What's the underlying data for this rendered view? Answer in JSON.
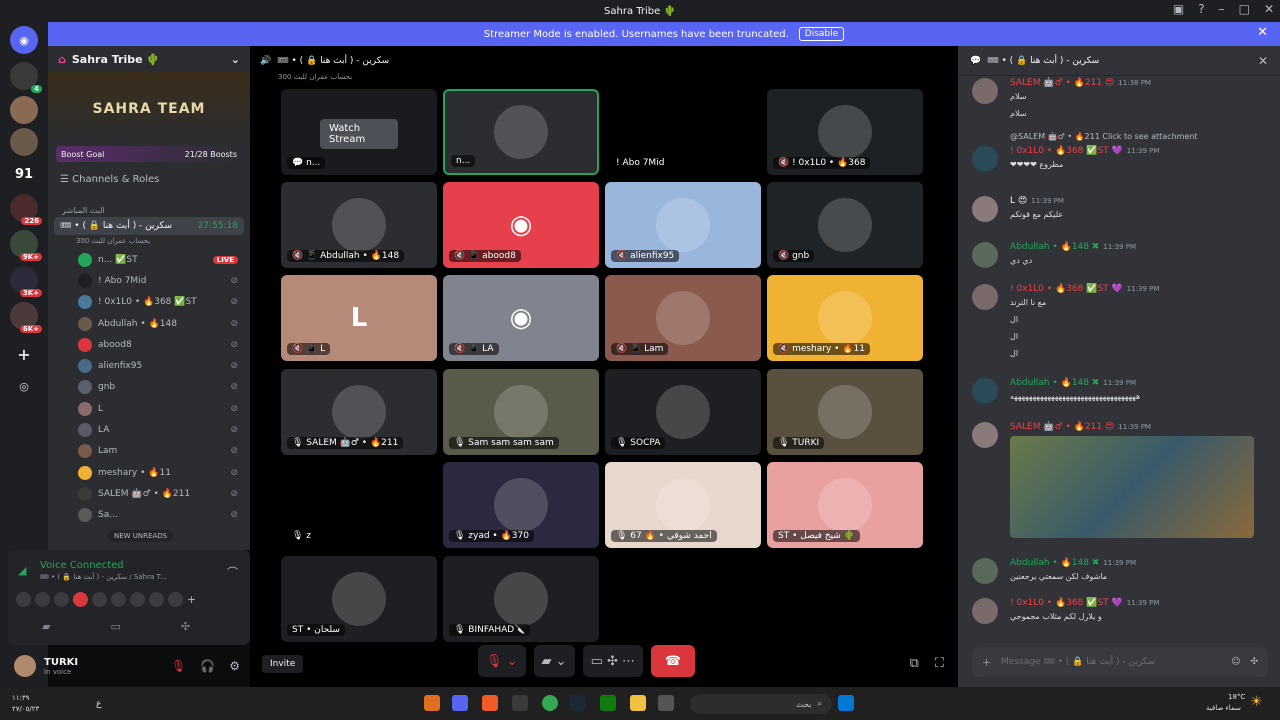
{
  "window": {
    "title": "Sahra Tribe 🌵"
  },
  "banner": {
    "text": "Streamer Mode is enabled. Usernames have been truncated.",
    "button": "Disable"
  },
  "rail": {
    "count_label": "91",
    "badges": [
      "226",
      "9K+",
      "3K+",
      "6K+"
    ]
  },
  "sidebar": {
    "guild_name": "Sahra Tribe 🌵",
    "banner_text": "SAHRA TEAM",
    "boost_goal": "Boost Goal",
    "boost_count": "21/28 Boosts",
    "channels_roles": "Channels & Roles",
    "category": "البث المباشر",
    "voice_channel": "🎟 • ( 🔒 أبث هنا ) - سكرين",
    "voice_timer": "27:55:18",
    "voice_sub": "300 بحساب عمران للبث",
    "live_badge": "LIVE",
    "users": [
      "n... ✅ST",
      "! Abo 7Mid",
      "! 0x1L0 • 🔥368 ✅ST",
      "Abdullah • 🔥148",
      "abood8",
      "alienfix95",
      "gnb",
      "L",
      "LA",
      "Lam",
      "meshary • 🔥11",
      "SALEM 🤖♂ • 🔥211",
      "Sa..."
    ],
    "new_unreads": "NEW UNREADS"
  },
  "voice_panel": {
    "status": "Voice Connected",
    "channel": "🎟 • ( 🔒 أبث هنا ) - سكرين / Sahra T..."
  },
  "user": {
    "name": "TURKI",
    "status": "In voice"
  },
  "stage": {
    "header": "🎟 • ( 🔒 أبث هنا ) - سكرين",
    "sub": "300 بحساب عمران للبث",
    "watch_label": "Watch Stream",
    "tiles": [
      {
        "label": "💬 n...",
        "bg": "#1a1b1e"
      },
      {
        "label": "n...",
        "bg": "#2b2d31"
      },
      {
        "label": "! Abo 7Mid",
        "bg": "#000000"
      },
      {
        "label": "🔇 ! 0x1L0 • 🔥368",
        "bg": "#1e2124"
      },
      {
        "label": "🔇 📱 Abdullah • 🔥148",
        "bg": "#2b2d31"
      },
      {
        "label": "🔇 📱 abood8",
        "bg": "#e5404b"
      },
      {
        "label": "🔇 alienfix95",
        "bg": "#9bb6dd"
      },
      {
        "label": "🔇 gnb",
        "bg": "#1f2428"
      },
      {
        "label": "🔇 📱 L",
        "bg": "#b58a79"
      },
      {
        "label": "🔇 📱 LA",
        "bg": "#80848e"
      },
      {
        "label": "🔇 📱 Lam",
        "bg": "#8a5a4e"
      },
      {
        "label": "🔇 meshary • 🔥11",
        "bg": "#f0b232"
      },
      {
        "label": "🎙 SALEM 🤖♂ • 🔥211",
        "bg": "#2b2d31"
      },
      {
        "label": "🎙 Sam sam sam sam",
        "bg": "#5a5a4a"
      },
      {
        "label": "🎙 SOCPA",
        "bg": "#1e1f22"
      },
      {
        "label": "🎙 TURKI",
        "bg": "#5a5040"
      },
      {
        "label": "🎙 z",
        "bg": "#000000"
      },
      {
        "label": "🎙 zyad • 🔥370",
        "bg": "#2b2840"
      },
      {
        "label": "🎙 67 🔥 • احمد شوقي",
        "bg": "#e8d7cc"
      },
      {
        "label": "ST • شيخ فيصل 🌵",
        "bg": "#e8a0a0"
      },
      {
        "label": "ST • سلحان",
        "bg": "#1e1f22"
      },
      {
        "label": "🎙 BINFAHAD🔪",
        "bg": "#1e1f22"
      }
    ],
    "invite": "Invite"
  },
  "chat": {
    "header": "🎟 • ( 🔒 أبث هنا ) - سكرين",
    "messages": [
      {
        "name": "SALEM 🤖♂ • 🔥211 😍",
        "time": "11:38 PM",
        "text": "سلام / سلام",
        "color": "#f23f43"
      },
      {
        "name": "! 0x1L0 • 🔥368 ✅ST 💜",
        "time": "11:39 PM",
        "text": "❤❤❤❤ مطروع",
        "color": "#f23f43",
        "reply": "@SALEM 🤖♂ • 🔥211 Click to see attachment"
      },
      {
        "name": "L 😍",
        "time": "11:39 PM",
        "text": "عليكم مع قوتكم",
        "color": "#f2f3f5"
      },
      {
        "name": "Abdullah • 🔥148 ✖",
        "time": "11:39 PM",
        "text": "دي دي",
        "color": "#23a55a"
      },
      {
        "name": "! 0x1L0 • 🔥368 ✅ST 💜",
        "time": "11:39 PM",
        "text": "مع نا الترند / ال / ال / ال",
        "color": "#f23f43"
      },
      {
        "name": "Abdullah • 🔥148 ✖",
        "time": "11:39 PM",
        "text": "ههههههههههههههههههههههههههههههههههه",
        "color": "#23a55a"
      },
      {
        "name": "SALEM 🤖♂ • 🔥211 😍",
        "time": "11:39 PM",
        "text": "",
        "color": "#f23f43"
      },
      {
        "name": "Abdullah • 🔥148 ✖",
        "time": "11:39 PM",
        "text": "ماشوف لكن سمعتي يرجعنين",
        "color": "#23a55a"
      },
      {
        "name": "! 0x1L0 • 🔥368 ✅ST 💜",
        "time": "11:39 PM",
        "text": "و يلارل لكم مثلاب مجموجي",
        "color": "#f23f43"
      }
    ],
    "input_placeholder": "Message 🎟 • ( 🔒 أبث هنا ) - سكرين"
  },
  "taskbar": {
    "time": "١١:٣٩",
    "date": "٢٧/٠٥/٢٣",
    "lang": "ع",
    "search": "بحث",
    "weather": "18°C",
    "weather_sub": "سماء صافية"
  }
}
